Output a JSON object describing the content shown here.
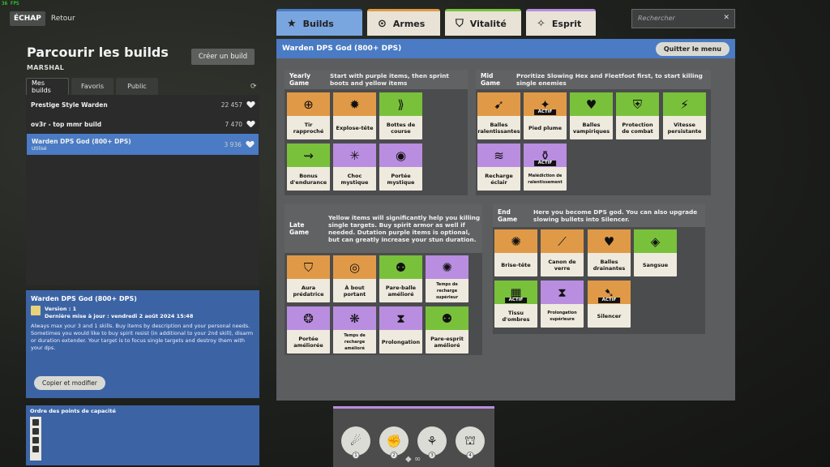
{
  "fps": "36 FPS",
  "topbar": {
    "esc_label": "ÉCHAP",
    "back_label": "Retour"
  },
  "left": {
    "title": "Parcourir les builds",
    "hero": "MARSHAL",
    "create_label": "Créer un build",
    "tabs": [
      "Mes builds",
      "Favoris",
      "Public"
    ],
    "builds": [
      {
        "name": "Prestige Style Warden",
        "count": "22 457"
      },
      {
        "name": "ov3r - top mmr build",
        "count": "7 470"
      },
      {
        "name": "Warden DPS God (800+ DPS)",
        "count": "3 936",
        "sub": "Utilisé"
      }
    ],
    "detail": {
      "title": "Warden DPS God (800+ DPS)",
      "version": "Version : 1",
      "updated": "Dernière mise à jour : vendredi 2 août 2024 15:48",
      "description": "Always max your 3 and 1 skills. Buy items by description and your personal needs. Sometimes you would like to buy spirit resist (in additional to your 2nd skill), disarm or duration extender. Your target is to focus single targets and destroy them with your dps.",
      "copy_label": "Copier et modifier"
    },
    "order_title": "Ordre des points de capacité"
  },
  "main": {
    "tabs": [
      {
        "label": "Builds",
        "icon": "star-icon",
        "color": "#4a7bc4"
      },
      {
        "label": "Armes",
        "icon": "weapon-icon",
        "color": "#e09a47"
      },
      {
        "label": "Vitalité",
        "icon": "shield-icon",
        "color": "#79c13b"
      },
      {
        "label": "Esprit",
        "icon": "spirit-icon",
        "color": "#b98de0"
      }
    ],
    "search_placeholder": "Rechercher",
    "header_title": "Warden DPS God (800+ DPS)",
    "quit_label": "Quitter le menu",
    "sections": {
      "yearly": {
        "name": "Yearly Game",
        "desc": "Start with purple items, then sprint boots and yellow items",
        "cards": [
          {
            "label": "Tir rapproché",
            "color": "orange",
            "glyph": "⊕"
          },
          {
            "label": "Explose-tête",
            "color": "orange",
            "glyph": "✹"
          },
          {
            "label": "Bottes de course",
            "color": "green",
            "glyph": "⟫"
          },
          {
            "label": "Bonus d'endurance",
            "color": "green",
            "glyph": "⇝"
          },
          {
            "label": "Choc mystique",
            "color": "purple",
            "glyph": "✳"
          },
          {
            "label": "Portée mystique",
            "color": "purple",
            "glyph": "◉"
          }
        ]
      },
      "mid": {
        "name": "Mid Game",
        "desc": "Proritize Slowing Hex and Fleetfoot first, to start killing single enemies",
        "cards": [
          {
            "label": "Balles ralentissantes",
            "color": "orange",
            "glyph": "➹"
          },
          {
            "label": "Pied plume",
            "color": "orange",
            "glyph": "✦",
            "actif": "ACTIF"
          },
          {
            "label": "Balles vampiriques",
            "color": "green",
            "glyph": "♥"
          },
          {
            "label": "Protection de combat",
            "color": "green",
            "glyph": "⛨"
          },
          {
            "label": "Vitesse persistante",
            "color": "green",
            "glyph": "⚡"
          },
          {
            "label": "Recharge éclair",
            "color": "purple",
            "glyph": "≋"
          },
          {
            "label": "Malédiction de ralentissement",
            "color": "purple",
            "glyph": "⚱",
            "actif": "ACTIF"
          }
        ]
      },
      "late": {
        "name": "Late Game",
        "desc": "Yellow items will significantly help you killing single targets. Buy spirit armor as well if needed. Dutation purple items is optional, but can greatly increase your stun duration.",
        "cards": [
          {
            "label": "Aura prédatrice",
            "color": "orange",
            "glyph": "⛉"
          },
          {
            "label": "À bout portant",
            "color": "orange",
            "glyph": "◎"
          },
          {
            "label": "Pare-balle amélioré",
            "color": "green",
            "glyph": "⚉"
          },
          {
            "label": "Temps de recharge supérieur",
            "color": "purple",
            "glyph": "✺"
          },
          {
            "label": "Portée améliorée",
            "color": "purple",
            "glyph": "❂"
          },
          {
            "label": "Temps de recharge amélioré",
            "color": "purple",
            "glyph": "❋"
          },
          {
            "label": "Prolongation",
            "color": "purple",
            "glyph": "⧗"
          },
          {
            "label": "Pare-esprit amélioré",
            "color": "green",
            "glyph": "⚉"
          }
        ]
      },
      "end": {
        "name": "End Game",
        "desc": "Here you become DPS god. You can also upgrade slowing bullets into Silencer.",
        "cards": [
          {
            "label": "Brise-tête",
            "color": "orange",
            "glyph": "✺"
          },
          {
            "label": "Canon de verre",
            "color": "orange",
            "glyph": "⟋"
          },
          {
            "label": "Balles drainantes",
            "color": "orange",
            "glyph": "♥"
          },
          {
            "label": "Sangsue",
            "color": "green",
            "glyph": "◈"
          },
          {
            "label": "Tissu d'ombres",
            "color": "green",
            "glyph": "▦",
            "actif": "ACTIF"
          },
          {
            "label": "Prolongation supérieure",
            "color": "purple",
            "glyph": "⧗"
          },
          {
            "label": "Silencer",
            "color": "orange",
            "glyph": "➷",
            "actif": "ACTIF"
          }
        ]
      }
    }
  },
  "abilities": [
    {
      "num": "1",
      "glyph": "☄"
    },
    {
      "num": "2",
      "glyph": "✊"
    },
    {
      "num": "3",
      "glyph": "⚘"
    },
    {
      "num": "4",
      "glyph": "⛫"
    }
  ]
}
